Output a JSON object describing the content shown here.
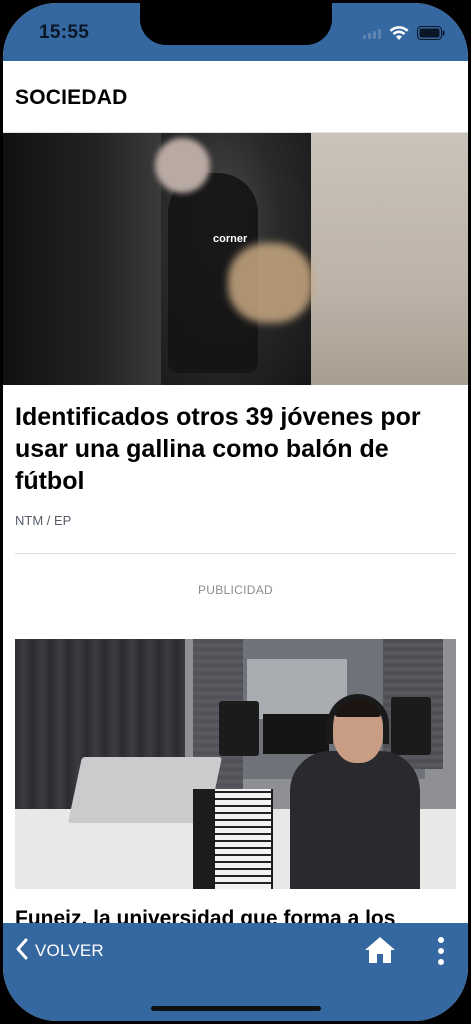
{
  "status_bar": {
    "time": "15:55",
    "icons": [
      "signal-icon",
      "wifi-icon",
      "battery-icon"
    ]
  },
  "header": {
    "section_title": "SOCIEDAD"
  },
  "article": {
    "image_tag": "corner",
    "title": "Identificados otros 39 jóvenes por usar una gallina como balón de fútbol",
    "source": "NTM / EP"
  },
  "ad": {
    "label": "PUBLICIDAD"
  },
  "next_article": {
    "title": "Funeiz, la universidad que forma a los"
  },
  "bottom_nav": {
    "back_label": "VOLVER",
    "icons": [
      "chevron-left-icon",
      "home-icon",
      "more-vertical-icon"
    ]
  },
  "colors": {
    "brand_blue": "#3567a0",
    "text_primary": "#000000",
    "text_muted": "#8c8c8c"
  }
}
